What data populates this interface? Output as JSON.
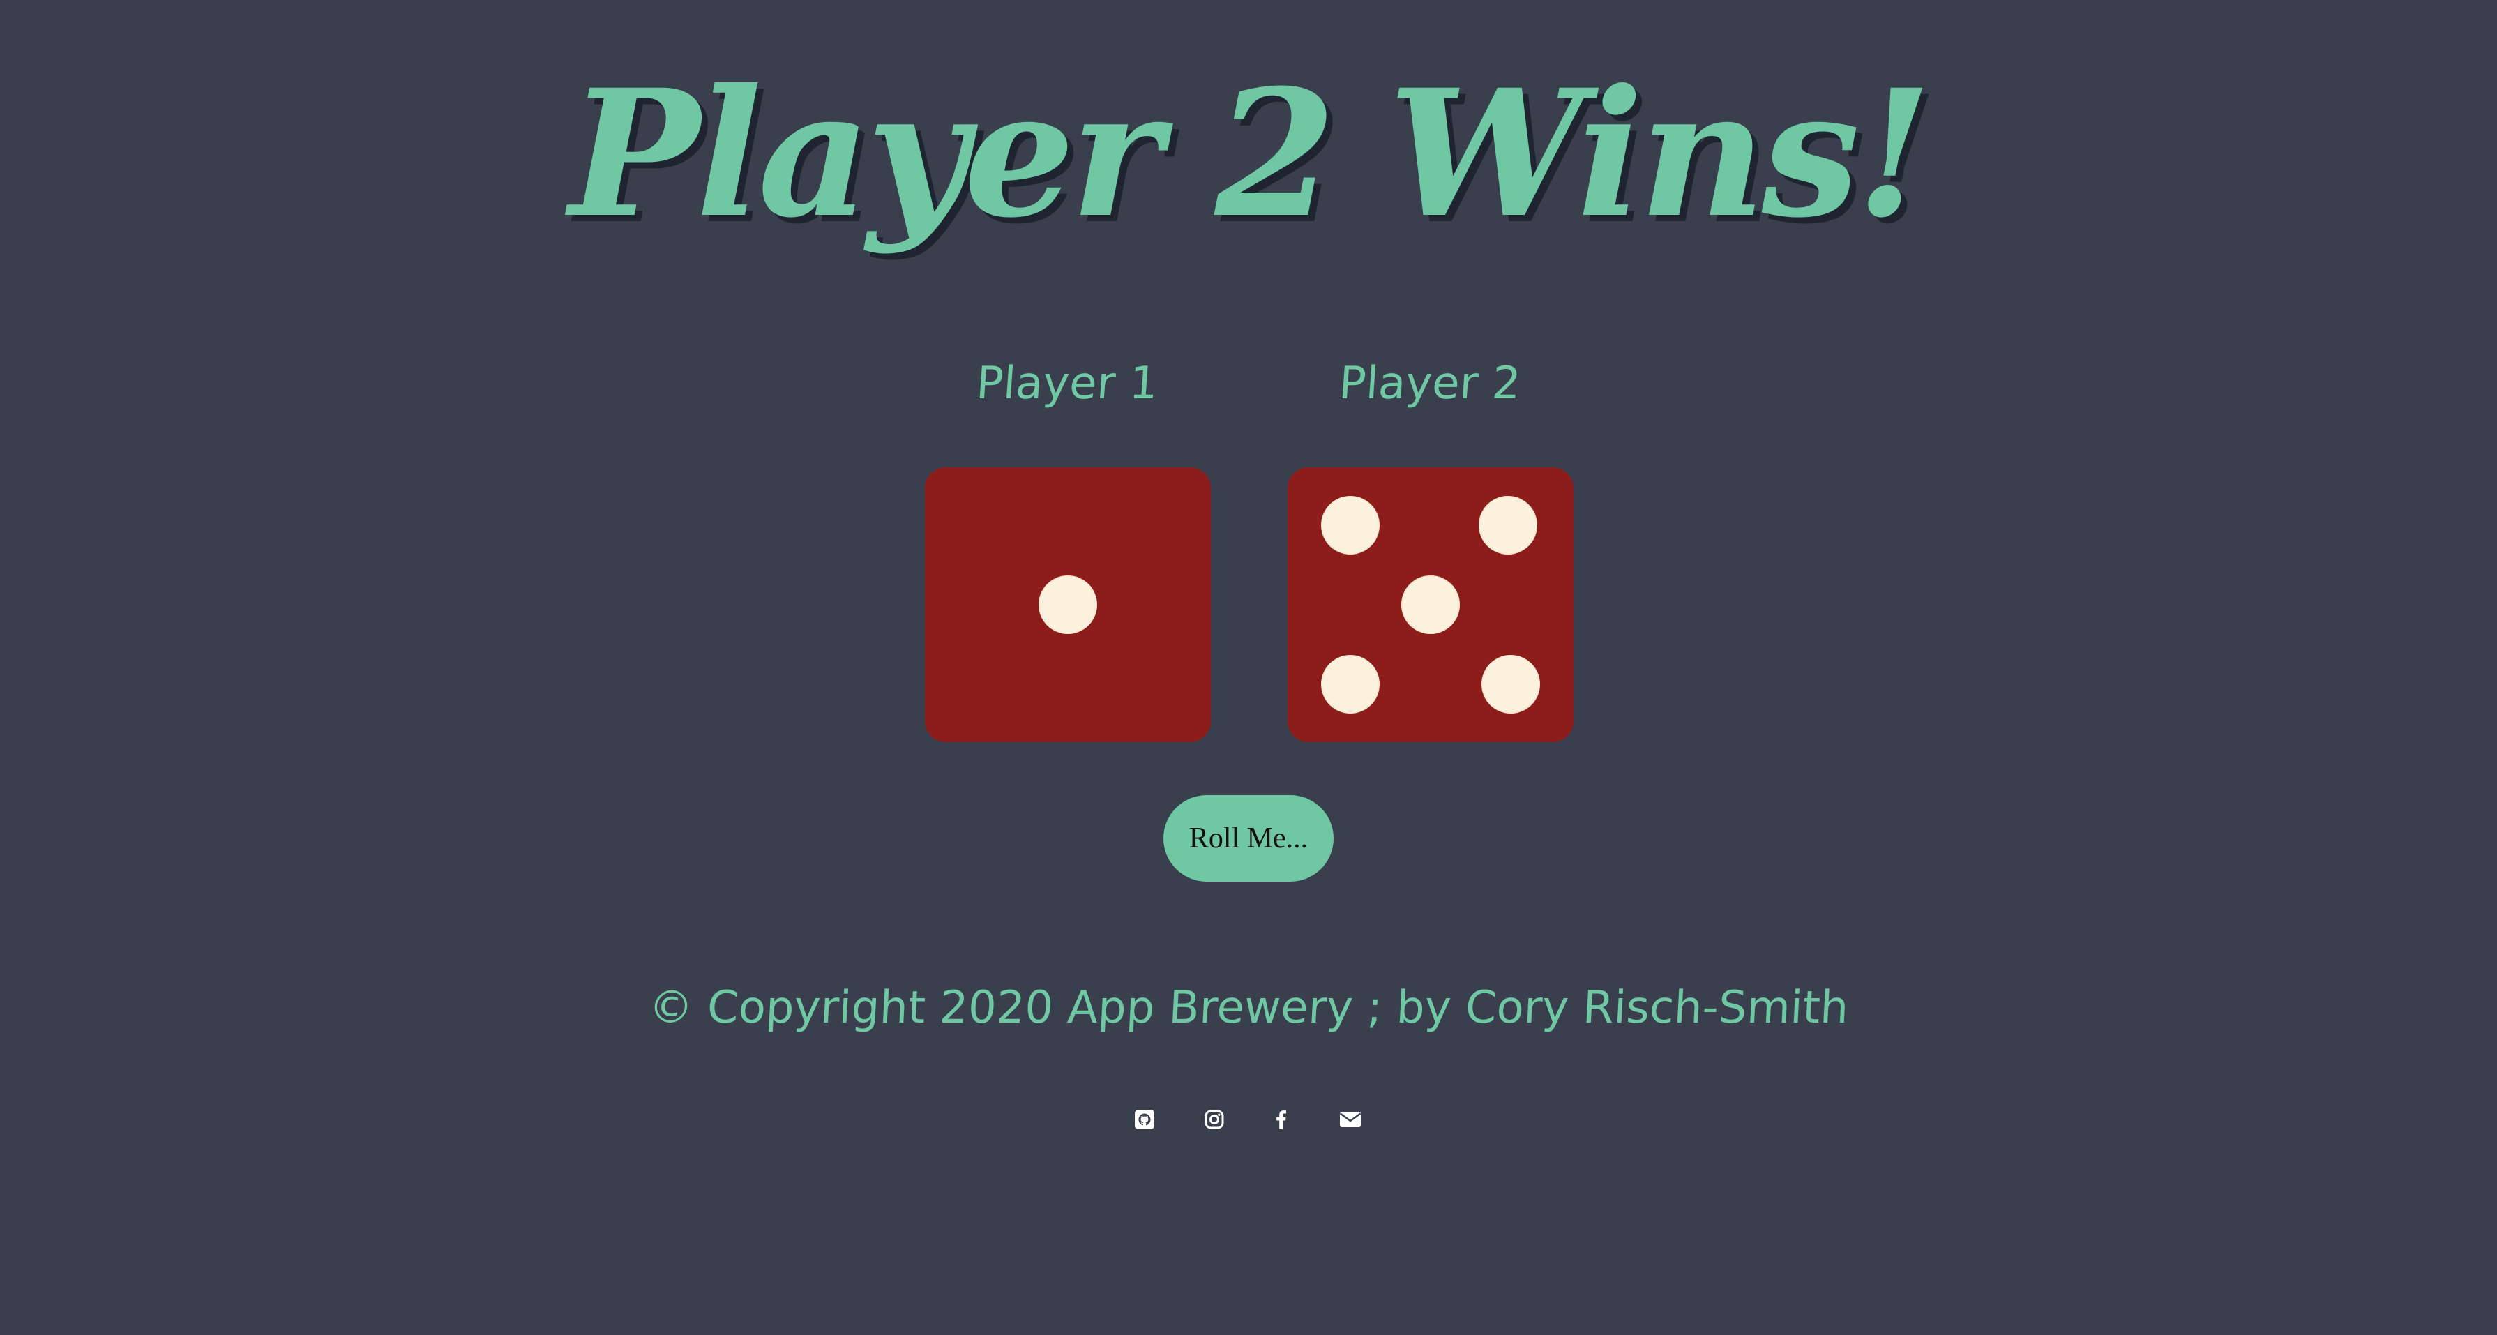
{
  "heading": "Player 2 Wins!",
  "players": [
    {
      "label": "Player 1",
      "die_value": 1
    },
    {
      "label": "Player 2",
      "die_value": 5
    }
  ],
  "roll_button": {
    "label": "Roll Me..."
  },
  "footer": {
    "copyright": "© Copyright 2020 App Brewery ; by Cory Risch-Smith",
    "social_icons": [
      "github-icon",
      "instagram-icon",
      "facebook-icon",
      "email-icon"
    ]
  },
  "colors": {
    "background": "#393f4d",
    "accent": "#6fc8a3",
    "die_face": "#8d1d1b",
    "pip": "#fbf1dd",
    "icon": "#ffffff"
  }
}
